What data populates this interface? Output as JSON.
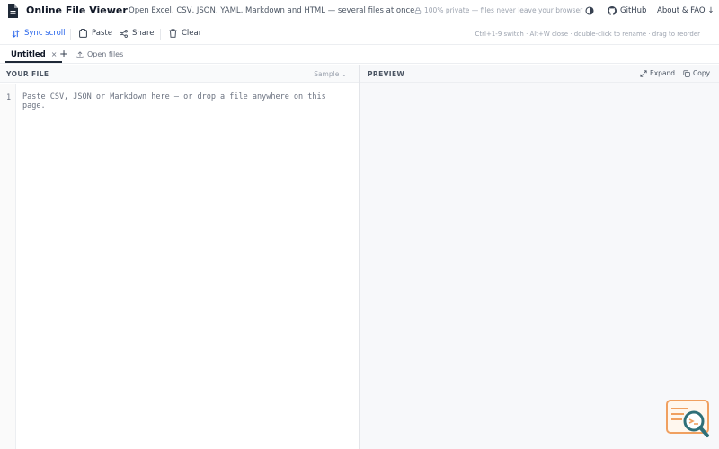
{
  "header": {
    "title": "Online File Viewer",
    "tagline": "Open Excel, CSV, JSON, YAML, Markdown and HTML — several files at once",
    "privacy": "100% private — files never leave your browser",
    "github": "GitHub",
    "about": "About & FAQ ↓"
  },
  "toolbar": {
    "sync_scroll": "Sync scroll",
    "paste": "Paste",
    "share": "Share",
    "clear": "Clear",
    "shortcuts": "Ctrl+1-9 switch · Alt+W close · double-click to rename · drag to reorder"
  },
  "tabs": {
    "items": [
      {
        "label": "Untitled",
        "close": "×"
      }
    ],
    "add": "+",
    "open_files": "Open files"
  },
  "left_pane": {
    "label": "YOUR FILE",
    "sample": "Sample ⌄",
    "line_number": "1",
    "placeholder": "Paste CSV, JSON or Markdown here — or drop a file anywhere on this page."
  },
  "right_pane": {
    "label": "PREVIEW",
    "expand": "Expand",
    "copy": "Copy"
  },
  "colors": {
    "accent": "#2563eb",
    "badge_orange": "#f0a060",
    "badge_teal": "#2f6f78"
  }
}
